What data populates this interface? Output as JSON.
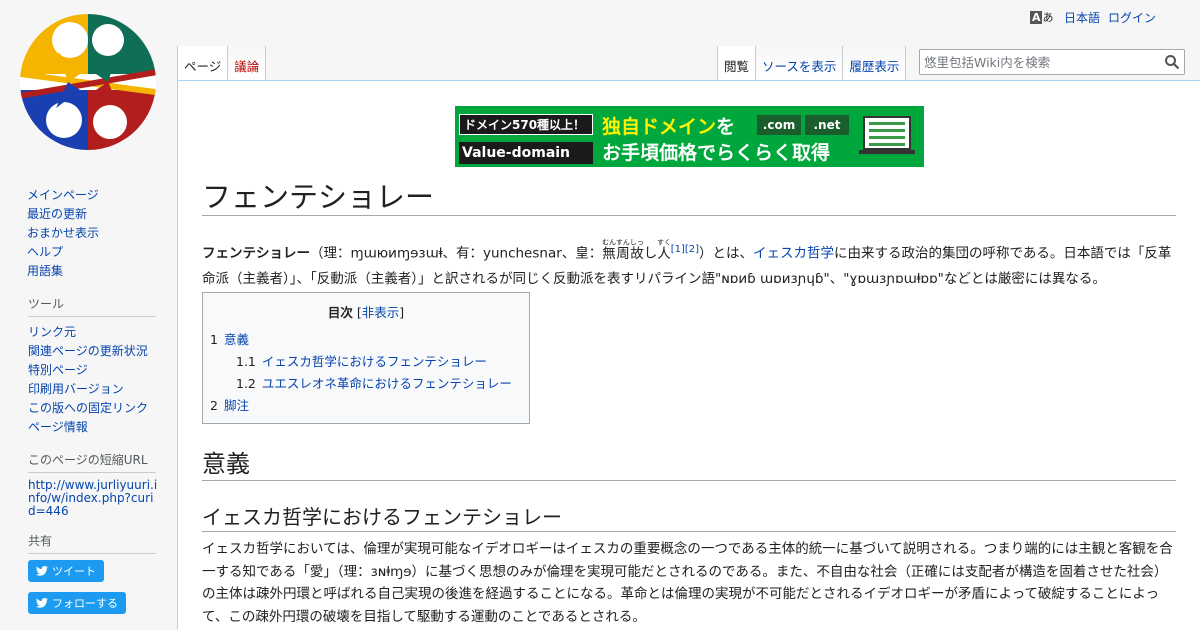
{
  "personal": {
    "language": "日本語",
    "login": "ログイン"
  },
  "tabs": {
    "page": "ページ",
    "talk": "議論",
    "read": "閲覧",
    "view_source": "ソースを表示",
    "history": "履歴表示"
  },
  "search": {
    "placeholder": "悠里包括Wiki内を検索"
  },
  "sidebar": {
    "nav": [
      "メインページ",
      "最近の更新",
      "おまかせ表示",
      "ヘルプ",
      "用語集"
    ],
    "tools_title": "ツール",
    "tools": [
      "リンク元",
      "関連ページの更新状況",
      "特別ページ",
      "印刷用バージョン",
      "この版への固定リンク",
      "ページ情報"
    ],
    "shorturl_title": "このページの短縮URL",
    "shorturl": "http://www.jurliyuuri.info/w/index.php?curid=446",
    "share_title": "共有",
    "tweet": "ツイート",
    "follow": "フォローする"
  },
  "banner": {
    "tag": "ドメイン570種以上！",
    "brand": "Value-domain",
    "line1_a": "独自ドメイン",
    "line1_b": "を",
    "com": ".com",
    "net": ".net",
    "line2": "お手頃価格でらくらく取得"
  },
  "article": {
    "title": "フェンテショレー",
    "lead": {
      "term": "フェンテショレー",
      "p1": "（理：ɱɯюиɱɘɜɯⱡ、有：yunchesnar、皇：",
      "ruby1": "無周故",
      "ruby1_rt": "むんすんしっ",
      "p2": "し",
      "ruby2": "人",
      "ruby2_rt": "すく",
      "ref1": "[1]",
      "ref2": "[2]",
      "p3": "）とは、",
      "link": "イェスカ哲学",
      "p4": "に由来する政治的集団の呼称である。日本語では「反革命派（主義者）」、「反動派（主義者）」と訳されるが同じく反動派を表すリパライン語\"ɴɒиɓ ɯɒиɜɲɥɓ\"、\"ɣɒɯɜɲɒɯⱡɒɒ\"などとは厳密には異なる。"
    },
    "toc": {
      "title": "目次",
      "toggle_open": "[",
      "toggle": "非表示",
      "toggle_close": "]",
      "items": [
        {
          "num": "1",
          "label": "意義",
          "sub": false
        },
        {
          "num": "1.1",
          "label": "イェスカ哲学におけるフェンテショレー",
          "sub": true
        },
        {
          "num": "1.2",
          "label": "ユエスレオネ革命におけるフェンテショレー",
          "sub": true
        },
        {
          "num": "2",
          "label": "脚注",
          "sub": false
        }
      ]
    },
    "section1": "意義",
    "subsection1": "イェスカ哲学におけるフェンテショレー",
    "paragraph": "イェスカ哲学においては、倫理が実現可能なイデオロギーはイェスカの重要概念の一つである主体的統一に基づいて説明される。つまり端的には主観と客観を合一する知である「愛」（理：ɜɴⱡɱɘ）に基づく思想のみが倫理を実現可能だとされるのである。また、不自由な社会（正確には支配者が構造を固着させた社会）の主体は疎外円環と呼ばれる自己実現の後進を経過することになる。革命とは倫理の実現が不可能だとされるイデオロギーが矛盾によって破綻することによって、この疎外円環の破壊を目指して駆動する運動のことであるとされる。"
  },
  "colors": {
    "link": "#0645ad",
    "new_link": "#ba0000",
    "banner_green": "#00a73c",
    "banner_yellow": "#fff200"
  }
}
